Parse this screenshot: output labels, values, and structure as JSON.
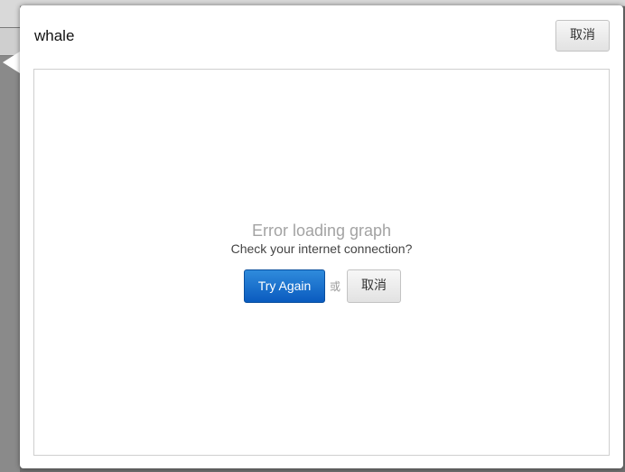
{
  "dialog": {
    "title": "whale",
    "cancel_label": "取消"
  },
  "graph": {
    "error_title": "Error loading graph",
    "error_subtitle": "Check your internet connection?",
    "retry_label": "Try Again",
    "or_text": "或",
    "cancel_label": "取消"
  },
  "colors": {
    "primary_button": "#0a5bbf",
    "backdrop": "#6f6f6f"
  }
}
